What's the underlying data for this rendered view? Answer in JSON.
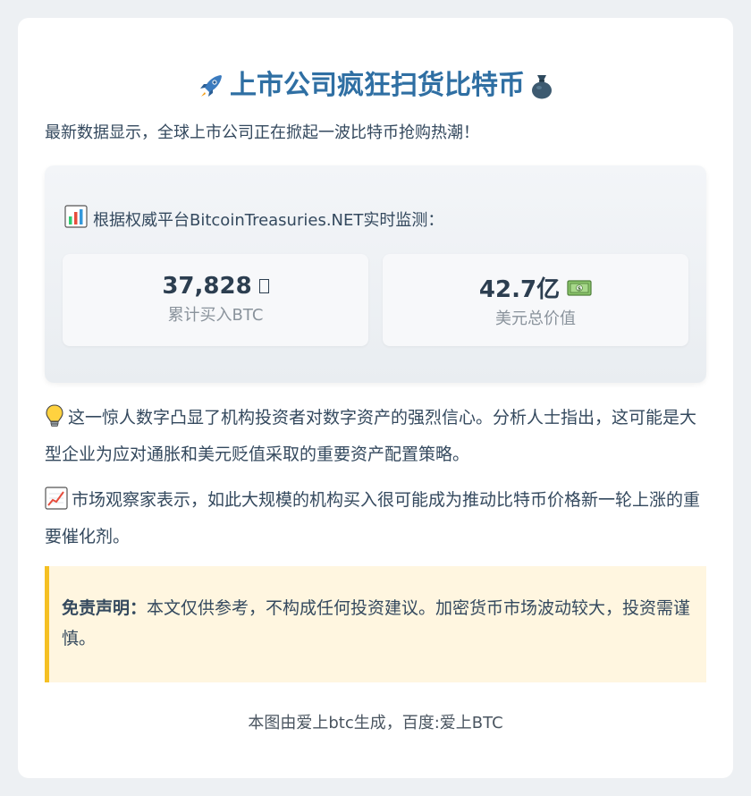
{
  "title": "上市公司疯狂扫货比特币",
  "title_icons": [
    "rocket-icon",
    "money-bag-icon"
  ],
  "intro": "最新数据显示，全球上市公司正在掀起一波比特币抢购热潮！",
  "stats": {
    "heading_icon": "bar-chart-icon",
    "heading": "根据权威平台BitcoinTreasuries.NET实时监测：",
    "items": [
      {
        "value": "37,828",
        "icon": "missing-glyph-box",
        "label": "累计买入BTC"
      },
      {
        "value": "42.7亿",
        "icon": "dollar-banknote-icon",
        "label": "美元总价值"
      }
    ]
  },
  "paragraphs": [
    {
      "icon": "light-bulb-icon",
      "text": "这一惊人数字凸显了机构投资者对数字资产的强烈信心。分析人士指出，这可能是大型企业为应对通胀和美元贬值采取的重要资产配置策略。"
    },
    {
      "icon": "chart-increasing-icon",
      "text": "市场观察家表示，如此大规模的机构买入很可能成为推动比特币价格新一轮上涨的重要催化剂。"
    }
  ],
  "disclaimer": {
    "label": "免责声明：",
    "text": "本文仅供参考，不构成任何投资建议。加密货币市场波动较大，投资需谨慎。"
  },
  "footer": "本图由爱上btc生成，百度:爱上BTC",
  "colors": {
    "title": "#2f6fa3",
    "text": "#34495e",
    "disclaimer_bg": "#fff6e0",
    "disclaimer_border": "#f5c023"
  }
}
